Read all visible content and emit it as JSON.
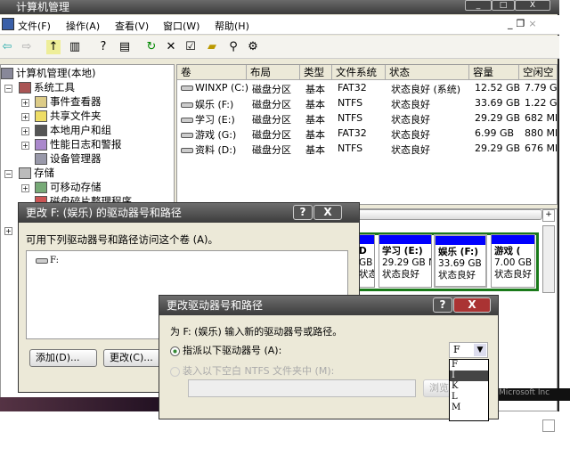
{
  "window": {
    "title": "计算机管理",
    "min": "_",
    "max": "□",
    "close": "X"
  },
  "menu": [
    "文件(F)",
    "操作(A)",
    "查看(V)",
    "窗口(W)",
    "帮助(H)"
  ],
  "inner_controls": {
    "min": "_",
    "restore": "❐",
    "close": "×"
  },
  "toolbar_icons": [
    "back-icon",
    "forward-icon",
    "up-folder-icon",
    "show-tree-icon",
    "help-icon",
    "details-icon",
    "refresh-icon",
    "delete-icon",
    "properties-icon",
    "open-icon",
    "search-icon",
    "settings-icon"
  ],
  "tree": {
    "root": "计算机管理(本地)",
    "items": [
      "系统工具",
      "事件查看器",
      "共享文件夹",
      "本地用户和组",
      "性能日志和警报",
      "设备管理器",
      "存储",
      "可移动存储",
      "磁盘碎片整理程序"
    ]
  },
  "list": {
    "columns": [
      "卷",
      "布局",
      "类型",
      "文件系统",
      "状态",
      "容量",
      "空闲空"
    ],
    "rows": [
      [
        "WINXP (C:)",
        "磁盘分区",
        "基本",
        "FAT32",
        "状态良好 (系统)",
        "12.52 GB",
        "7.79 G"
      ],
      [
        "娱乐 (F:)",
        "磁盘分区",
        "基本",
        "NTFS",
        "状态良好",
        "33.69 GB",
        "1.22 G"
      ],
      [
        "学习 (E:)",
        "磁盘分区",
        "基本",
        "NTFS",
        "状态良好",
        "29.29 GB",
        "682 MB"
      ],
      [
        "游戏 (G:)",
        "磁盘分区",
        "基本",
        "FAT32",
        "状态良好",
        "6.99 GB",
        "880 MB"
      ],
      [
        "资料 (D:)",
        "磁盘分区",
        "基本",
        "NTFS",
        "状态良好",
        "29.29 GB",
        "676 MB"
      ]
    ]
  },
  "graph": {
    "volumes": [
      {
        "name": "D",
        "size": "GB",
        "status": "状态良好"
      },
      {
        "name": "学习 (E:)",
        "size": "29.29 GB NTFS",
        "status": "状态良好"
      },
      {
        "name": "娱乐 (F:)",
        "size": "33.69 GB NTFS",
        "status": "状态良好"
      },
      {
        "name": "游戏 (",
        "size": "7.00 GB",
        "status": "状态良好"
      }
    ]
  },
  "dialog1": {
    "title": "更改 F: (娱乐) 的驱动器号和路径",
    "help": "?",
    "close": "X",
    "label": "可用下列驱动器号和路径访问这个卷 (A)。",
    "entries": [
      "F:"
    ],
    "add": "添加(D)...",
    "change": "更改(C)..."
  },
  "dialog2": {
    "title": "更改驱动器号和路径",
    "help": "?",
    "close": "X",
    "prompt": "为 F: (娱乐) 输入新的驱动器号或路径。",
    "radio1": "指派以下驱动器号 (A):",
    "radio2": "装入以下空白 NTFS 文件夹中 (M):",
    "browse": "浏览",
    "selected": "F",
    "options": [
      "F",
      "I",
      "K",
      "L",
      "M"
    ],
    "highlighted": "I"
  },
  "background_text": "Microsoft Inc"
}
